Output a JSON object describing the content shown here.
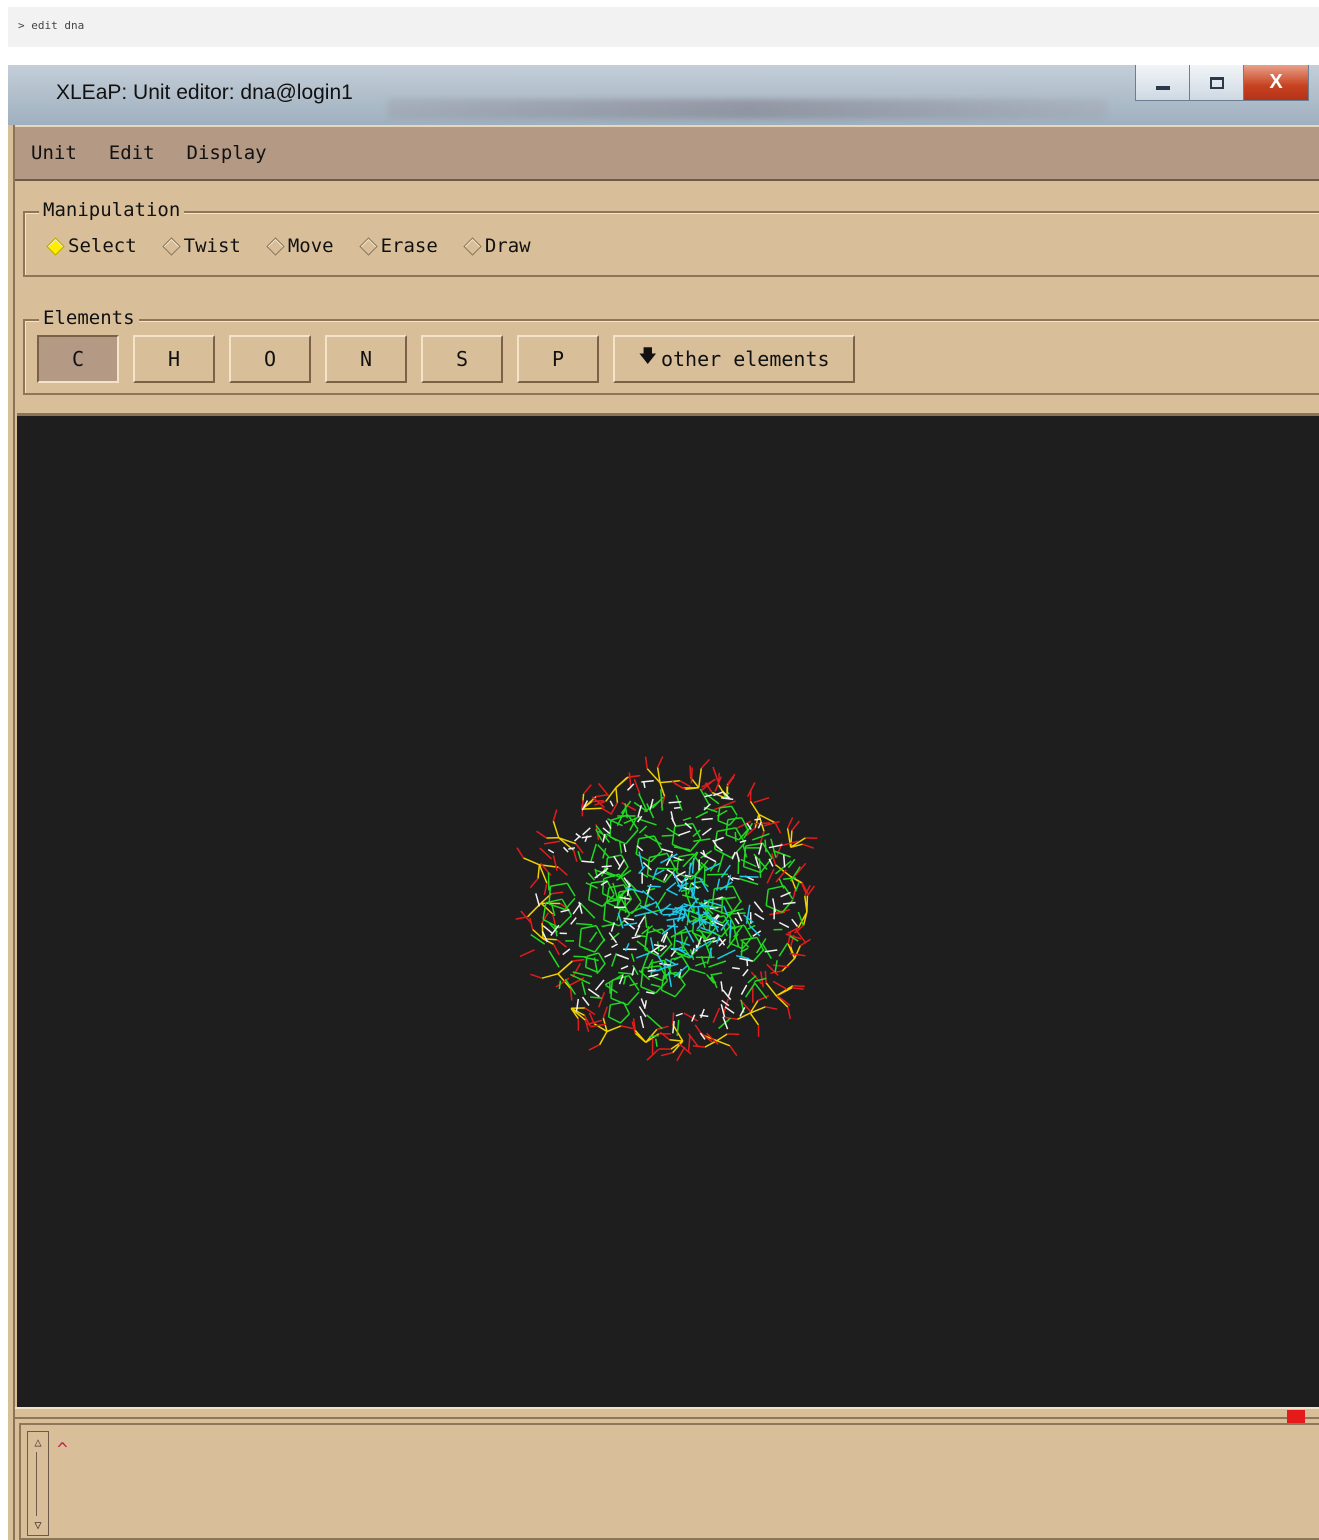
{
  "command": "> edit dna",
  "window": {
    "title": "XLEaP: Unit editor: dna@login1",
    "minimize_glyph": "minimize-icon",
    "maximize_glyph": "maximize-icon",
    "close_label": "X"
  },
  "menu": [
    "Unit",
    "Edit",
    "Display"
  ],
  "manipulation": {
    "label": "Manipulation",
    "options": [
      "Select",
      "Twist",
      "Move",
      "Erase",
      "Draw"
    ],
    "selected": "Select"
  },
  "elements": {
    "label": "Elements",
    "buttons": [
      "C",
      "H",
      "O",
      "N",
      "S",
      "P"
    ],
    "active": "C",
    "other_label": "other elements"
  },
  "console": {
    "caret": "^"
  },
  "colors": {
    "carbon": "#22d822",
    "oxygen": "#e21c1c",
    "phosphorus": "#f0d000",
    "hydrogen": "#f2f2f2",
    "nitrogen": "#22c8e8",
    "viewport_bg": "#1e1e1e",
    "ui_bg": "#d8bf9a"
  }
}
